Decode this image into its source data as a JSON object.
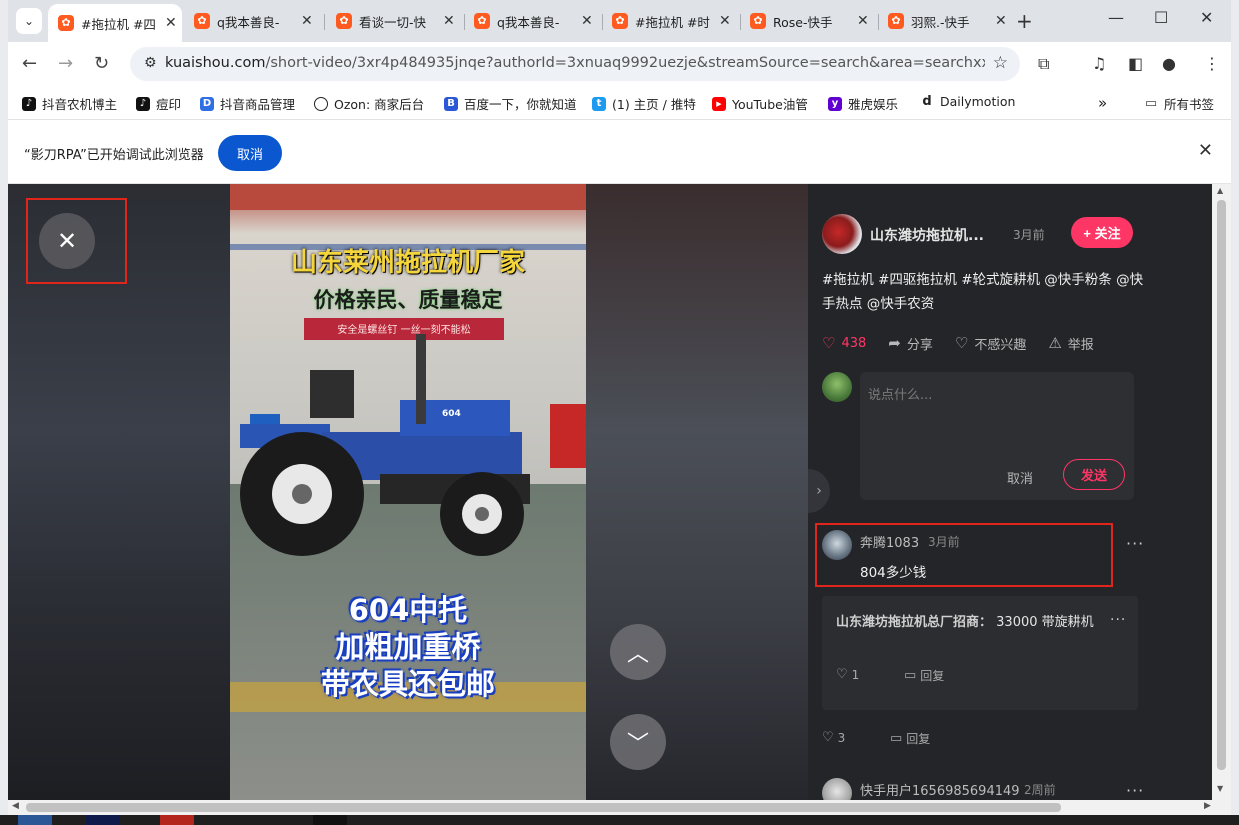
{
  "tabs": [
    {
      "title": "#拖拉机 #四"
    },
    {
      "title": "q我本善良-"
    },
    {
      "title": "看谈一切-快"
    },
    {
      "title": "q我本善良-"
    },
    {
      "title": "#拖拉机 #时"
    },
    {
      "title": "Rose-快手"
    },
    {
      "title": "羽熙.-快手"
    }
  ],
  "address": {
    "host": "kuaishou.com",
    "path": "/short-video/3xr4p484935jnqe?authorId=3xnuaq9992uezje&streamSource=search&area=searchxxnull&s..."
  },
  "bookmarks": [
    {
      "label": "抖音农机博主",
      "color": "#111111",
      "glyph": "♪"
    },
    {
      "label": "痘印",
      "color": "#111111",
      "glyph": "♪"
    },
    {
      "label": "抖音商品管理",
      "color": "#2f6fe4",
      "glyph": "D"
    },
    {
      "label": "Ozon: 商家后台",
      "color": "#222222",
      "glyph": "O"
    },
    {
      "label": "百度一下，你就知道",
      "color": "#2b58d6",
      "glyph": "B"
    },
    {
      "label": "(1) 主页 / 推特",
      "color": "#1d9bf0",
      "glyph": "t"
    },
    {
      "label": "YouTube油管",
      "color": "#ff0000",
      "glyph": "▶"
    },
    {
      "label": "雅虎娱乐",
      "color": "#6001d2",
      "glyph": "y"
    },
    {
      "label": "Dailymotion",
      "color": "#222222",
      "glyph": "d"
    }
  ],
  "bookmarks_all": "所有书签",
  "infobar": {
    "message": "“影刀RPA”已开始调试此浏览器",
    "cancel_label": "取消"
  },
  "video": {
    "headline": "山东莱州拖拉机厂家",
    "subline": "价格亲民、质量稳定",
    "banner": "安全是螺丝钉   一丝一刻不能松",
    "badge": "604",
    "bottom_lines": [
      "604中托",
      "加粗加重桥",
      "带农具还包邮"
    ]
  },
  "author": {
    "name": "山东潍坊拖拉机...",
    "time": "3月前",
    "follow_label": "+ 关注"
  },
  "caption": "#拖拉机 #四驱拖拉机 #轮式旋耕机 @快手粉条 @快手热点 @快手农资",
  "actions": {
    "likes": "438",
    "share": "分享",
    "not_interested": "不感兴趣",
    "report": "举报"
  },
  "comment_input": {
    "placeholder": "说点什么...",
    "cancel": "取消",
    "send": "发送"
  },
  "comments": [
    {
      "user": "奔腾1083",
      "time": "3月前",
      "text": "804多少钱",
      "reply_user": "山东潍坊拖拉机总厂招商：",
      "reply_text": "33000 带旋耕机",
      "reply_likes": "1",
      "reply_label": "回复",
      "likes": "3",
      "reply_label_2": "回复"
    },
    {
      "user": "快手用户1656985694149",
      "time": "2周前"
    }
  ],
  "colors": {
    "accent": "#fe3666",
    "annotation_box": "#e0261b",
    "browser_blue": "#0b57d0"
  }
}
